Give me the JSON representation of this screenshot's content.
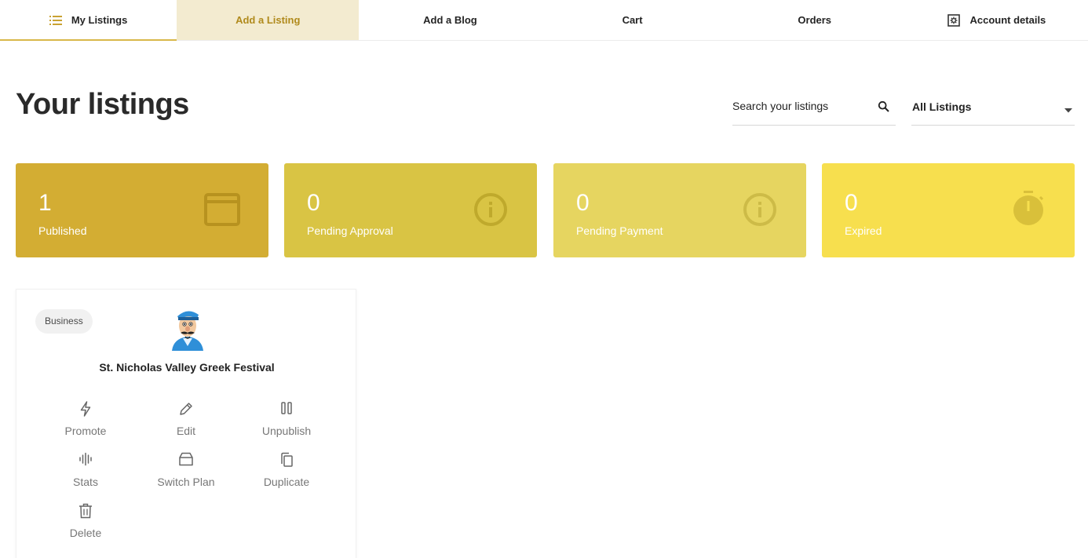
{
  "tabs": [
    {
      "label": "My Listings",
      "icon": "list-icon",
      "active": true
    },
    {
      "label": "Add a Listing",
      "highlight": true
    },
    {
      "label": "Add a Blog"
    },
    {
      "label": "Cart"
    },
    {
      "label": "Orders"
    },
    {
      "label": "Account details",
      "icon": "settings-icon"
    }
  ],
  "page": {
    "title": "Your listings"
  },
  "search": {
    "placeholder": "Search your listings",
    "icon": "search-icon"
  },
  "filter": {
    "value": "All Listings",
    "icon": "caret-down-icon"
  },
  "stats": [
    {
      "count": "1",
      "label": "Published",
      "color": "#d3ad33",
      "icon": "browser-window-icon"
    },
    {
      "count": "0",
      "label": "Pending Approval",
      "color": "#d9c444",
      "icon": "info-icon"
    },
    {
      "count": "0",
      "label": "Pending Payment",
      "color": "#e6d560",
      "icon": "info-icon"
    },
    {
      "count": "0",
      "label": "Expired",
      "color": "#f7df4e",
      "icon": "stopwatch-icon"
    }
  ],
  "listing": {
    "category": "Business",
    "title": "St. Nicholas Valley Greek Festival",
    "logo": "cartoon-chef-logo",
    "actions": [
      {
        "label": "Promote",
        "icon": "bolt-icon"
      },
      {
        "label": "Edit",
        "icon": "pencil-icon"
      },
      {
        "label": "Unpublish",
        "icon": "pause-icon"
      },
      {
        "label": "Stats",
        "icon": "waveform-icon"
      },
      {
        "label": "Switch Plan",
        "icon": "box-icon"
      },
      {
        "label": "Duplicate",
        "icon": "copy-icon"
      },
      {
        "label": "Delete",
        "icon": "trash-icon"
      }
    ]
  },
  "colors": {
    "accent": "#d8b84a",
    "tab_highlight_bg": "#f3ebd0",
    "tab_highlight_text": "#b08a1c"
  }
}
